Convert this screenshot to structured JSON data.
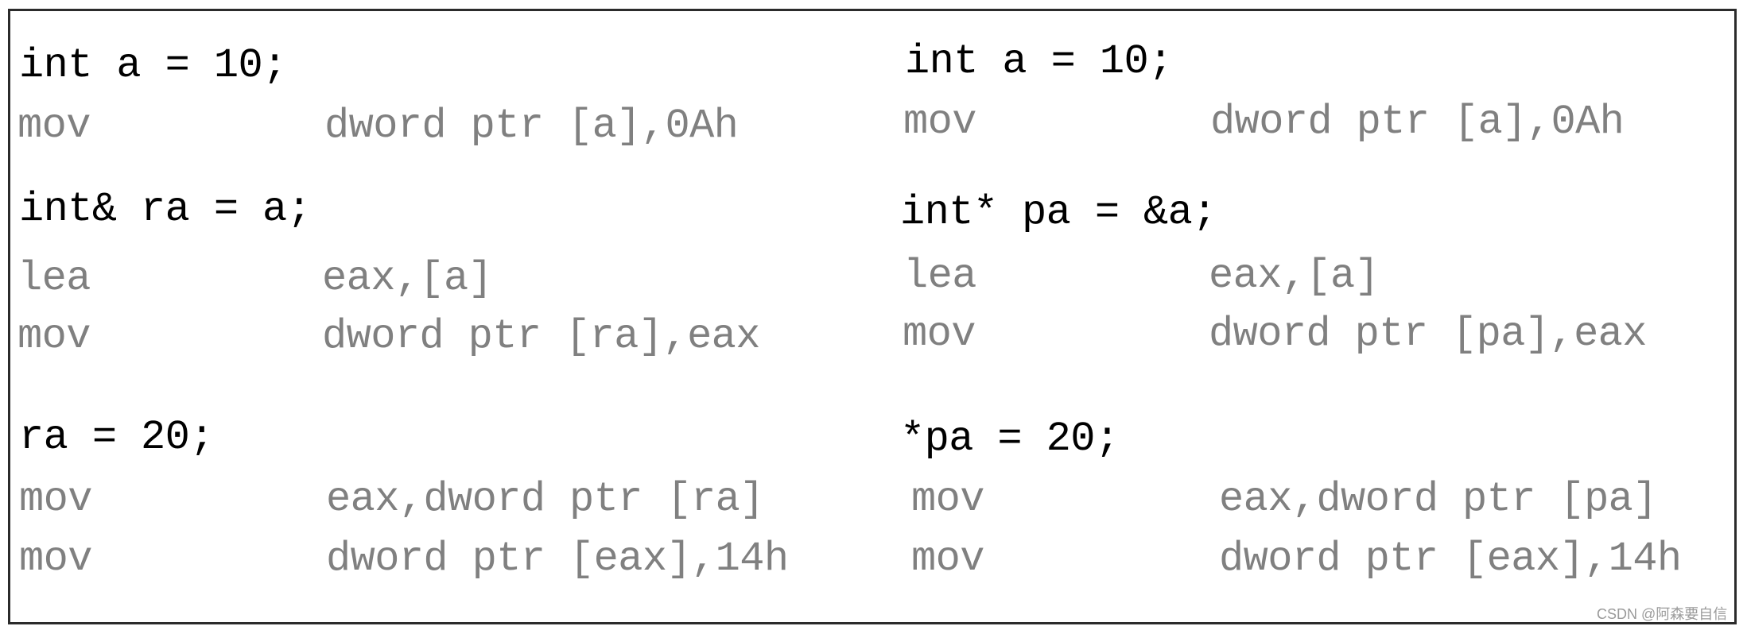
{
  "left_column": {
    "blocks": [
      {
        "source": "int a = 10;",
        "asm": [
          {
            "mnemonic": "mov",
            "operands": "dword ptr [a],0Ah"
          }
        ]
      },
      {
        "source": "int& ra = a;",
        "asm": [
          {
            "mnemonic": "lea",
            "operands": "eax,[a]"
          },
          {
            "mnemonic": "mov",
            "operands": "dword ptr [ra],eax"
          }
        ]
      },
      {
        "source": "ra = 20;",
        "asm": [
          {
            "mnemonic": "mov",
            "operands": "eax,dword ptr [ra]"
          },
          {
            "mnemonic": "mov",
            "operands": "dword ptr [eax],14h"
          }
        ]
      }
    ]
  },
  "right_column": {
    "blocks": [
      {
        "source": "int a = 10;",
        "asm": [
          {
            "mnemonic": "mov",
            "operands": "dword ptr [a],0Ah"
          }
        ]
      },
      {
        "source": "int* pa = &a;",
        "asm": [
          {
            "mnemonic": "lea",
            "operands": "eax,[a]"
          },
          {
            "mnemonic": "mov",
            "operands": "dword ptr [pa],eax"
          }
        ]
      },
      {
        "source": "*pa = 20;",
        "asm": [
          {
            "mnemonic": "mov",
            "operands": "eax,dword ptr [pa]"
          },
          {
            "mnemonic": "mov",
            "operands": "dword ptr [eax],14h"
          }
        ]
      }
    ]
  },
  "watermark": "CSDN @阿森要自信",
  "colors": {
    "source_text": "#000000",
    "asm_text": "#808080",
    "border": "#2b2b2b",
    "watermark": "#9a9a9a"
  }
}
